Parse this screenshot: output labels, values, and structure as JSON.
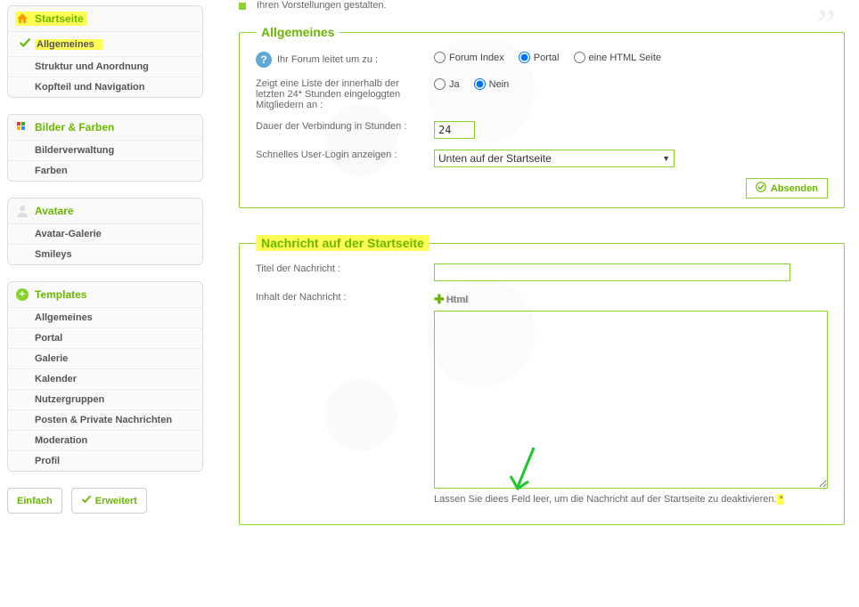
{
  "intro_text": "Ihren Vorstellungen gestalten.",
  "sidebar": {
    "sections": [
      {
        "title": "Startseite",
        "items": [
          "Allgemeines",
          "Struktur und Anordnung",
          "Kopfteil und Navigation"
        ],
        "selected_index": 0,
        "highlighted": true
      },
      {
        "title": "Bilder & Farben",
        "items": [
          "Bilderverwaltung",
          "Farben"
        ]
      },
      {
        "title": "Avatare",
        "items": [
          "Avatar-Galerie",
          "Smileys"
        ]
      },
      {
        "title": "Templates",
        "items": [
          "Allgemeines",
          "Portal",
          "Galerie",
          "Kalender",
          "Nutzergruppen",
          "Posten & Private Nachrichten",
          "Moderation",
          "Profil"
        ]
      }
    ],
    "simple_label": "Einfach",
    "advanced_label": "Erweitert"
  },
  "panel1": {
    "legend": "Allgemeines",
    "redirect_label": "Ihr Forum leitet um zu :",
    "redirect_options": [
      "Forum Index",
      "Portal",
      "eine HTML Seite"
    ],
    "redirect_selected": 1,
    "list24_label": "Zeigt eine Liste der innerhalb der letzten 24* Stunden eingeloggten Mitgliedern an :",
    "yes": "Ja",
    "no": "Nein",
    "list24_selected": "Nein",
    "duration_label": "Dauer der Verbindung in Stunden :",
    "duration_value": "24",
    "quicklogin_label": "Schnelles User-Login anzeigen :",
    "quicklogin_value": "Unten auf der Startseite",
    "submit_label": "Absenden"
  },
  "panel2": {
    "legend": "Nachricht auf der Startseite",
    "title_label": "Titel der Nachricht :",
    "title_value": "",
    "content_label": "Inhalt der Nachricht :",
    "html_toggle": "Html",
    "content_value": "",
    "hint_a": "Lassen Sie die",
    "hint_b": "es Feld leer, um die Nachricht auf der Startseite zu deaktivieren.",
    "hint_star": " * "
  }
}
